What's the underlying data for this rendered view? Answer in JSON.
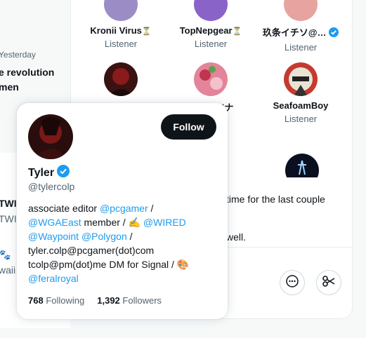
{
  "background_feed": {
    "date": "Yesterday",
    "title": "e revolution\nmen",
    "line1": "TWI",
    "line2": "TWI",
    "emoji": "🐾",
    "line3": "waii"
  },
  "space": {
    "listeners": [
      {
        "name": "Kronii Virus",
        "role": "Listener",
        "hourglass": "⏳"
      },
      {
        "name": "TopNepgear",
        "role": "Listener",
        "hourglass": "⏳"
      },
      {
        "name": "玖条イチソ@…",
        "role": "Listener"
      },
      {
        "name": "",
        "role": ""
      },
      {
        "name": "ちちキツナ",
        "role": ""
      },
      {
        "name": "SeafoamBoy",
        "role": "Listener"
      }
    ],
    "snippet_line1": "time for the last couple",
    "snippet_line2": "well."
  },
  "hovercard": {
    "follow_label": "Follow",
    "name": "Tyler",
    "handle": "@tylercolp",
    "bio": {
      "t1": "associate editor ",
      "l1": "@pcgamer",
      "t2": " /",
      "l2": "@WGAEast",
      "t3": " member / ✍️ ",
      "l3": "@WIRED",
      "l4": "@Waypoint",
      "t4": " ",
      "l5": "@Polygon",
      "t5": " /",
      "t6": "tyler.colp@pcgamer(dot)com",
      "t7": "tcolp@pm(dot)me DM for Signal / 🎨",
      "l6": "@feralroyal"
    },
    "following_count": "768",
    "following_label": "Following",
    "followers_count": "1,392",
    "followers_label": "Followers"
  },
  "colors": {
    "link": "#1d9bf0",
    "verified": "#1d9bf0",
    "follow_bg": "#0f1419"
  }
}
